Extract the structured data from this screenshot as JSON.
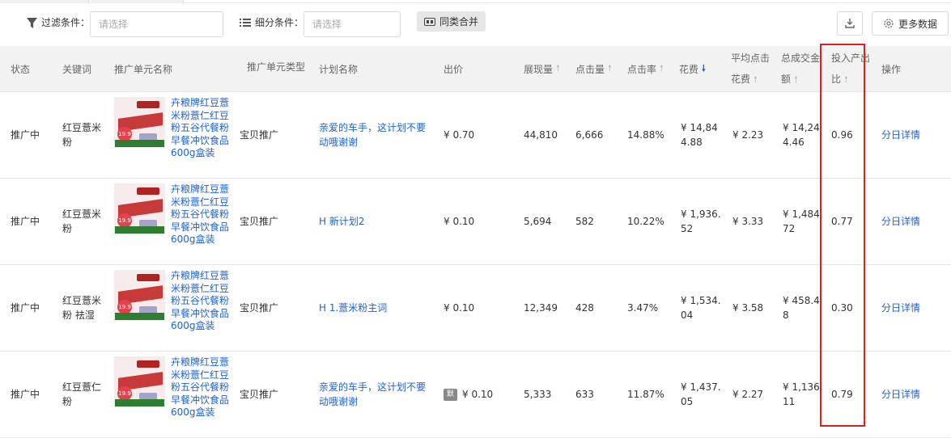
{
  "filter": {
    "filter_label": "过滤条件：",
    "filter_placeholder": "请选择",
    "sub_label": "细分条件：",
    "sub_placeholder": "请选择",
    "merge_label": "同类合并",
    "more_label": "更多数据"
  },
  "columns": {
    "status": "状态",
    "keyword": "关键词",
    "unit_name": "推广单元名称",
    "unit_type": "推广单元类型",
    "plan": "计划名称",
    "bid": "出价",
    "impressions": "展现量",
    "clicks": "点击量",
    "ctr": "点击率",
    "cost": "花费",
    "cpc_1": "平均点击",
    "cpc_2": "花费",
    "gmv_1": "总成交金",
    "gmv_2": "额",
    "roi_1": "投入产出",
    "roi_2": "比",
    "action": "操作"
  },
  "rows": [
    {
      "status": "推广中",
      "keyword": "红豆薏米粉",
      "product": "卉粮牌红豆薏米粉薏仁红豆粉五谷代餐粉早餐冲饮食品600g盒装",
      "thumb_price": "19.9",
      "unit_type": "宝贝推广",
      "plan": "亲爱的车手，这计划不要动哦谢谢",
      "bid_icon": "",
      "bid": "¥ 0.70",
      "impressions": "44,810",
      "clicks": "6,666",
      "ctr": "14.88%",
      "cost": "¥ 14,844.88",
      "cpc": "¥ 2.23",
      "gmv": "¥ 14,244.46",
      "roi": "0.96",
      "action": "分日详情"
    },
    {
      "status": "推广中",
      "keyword": "红豆薏米粉",
      "product": "卉粮牌红豆薏米粉薏仁红豆粉五谷代餐粉早餐冲饮食品600g盒装",
      "thumb_price": "19.9",
      "unit_type": "宝贝推广",
      "plan": "H 新计划2",
      "bid_icon": "",
      "bid": "¥ 0.10",
      "impressions": "5,694",
      "clicks": "582",
      "ctr": "10.22%",
      "cost": "¥ 1,936.52",
      "cpc": "¥ 3.33",
      "gmv": "¥ 1,484.72",
      "roi": "0.77",
      "action": "分日详情"
    },
    {
      "status": "推广中",
      "keyword": "红豆薏米粉 祛湿",
      "product": "卉粮牌红豆薏米粉薏仁红豆粉五谷代餐粉早餐冲饮食品600g盒装",
      "thumb_price": "19.9",
      "unit_type": "宝贝推广",
      "plan": "H 1.薏米粉主词",
      "bid_icon": "",
      "bid": "¥ 0.10",
      "impressions": "12,349",
      "clicks": "428",
      "ctr": "3.47%",
      "cost": "¥ 1,534.04",
      "cpc": "¥ 3.58",
      "gmv": "¥ 458.48",
      "roi": "0.30",
      "action": "分日详情"
    },
    {
      "status": "推广中",
      "keyword": "红豆薏仁粉",
      "product": "卉粮牌红豆薏米粉薏仁红豆粉五谷代餐粉早餐冲饮食品600g盒装",
      "thumb_price": "19.9",
      "unit_type": "宝贝推广",
      "plan": "亲爱的车手，这计划不要动哦谢谢",
      "bid_icon": "默",
      "bid": "¥ 0.10",
      "impressions": "5,333",
      "clicks": "633",
      "ctr": "11.87%",
      "cost": "¥ 1,437.05",
      "cpc": "¥ 2.27",
      "gmv": "¥ 1,136.11",
      "roi": "0.79",
      "action": "分日详情"
    }
  ]
}
